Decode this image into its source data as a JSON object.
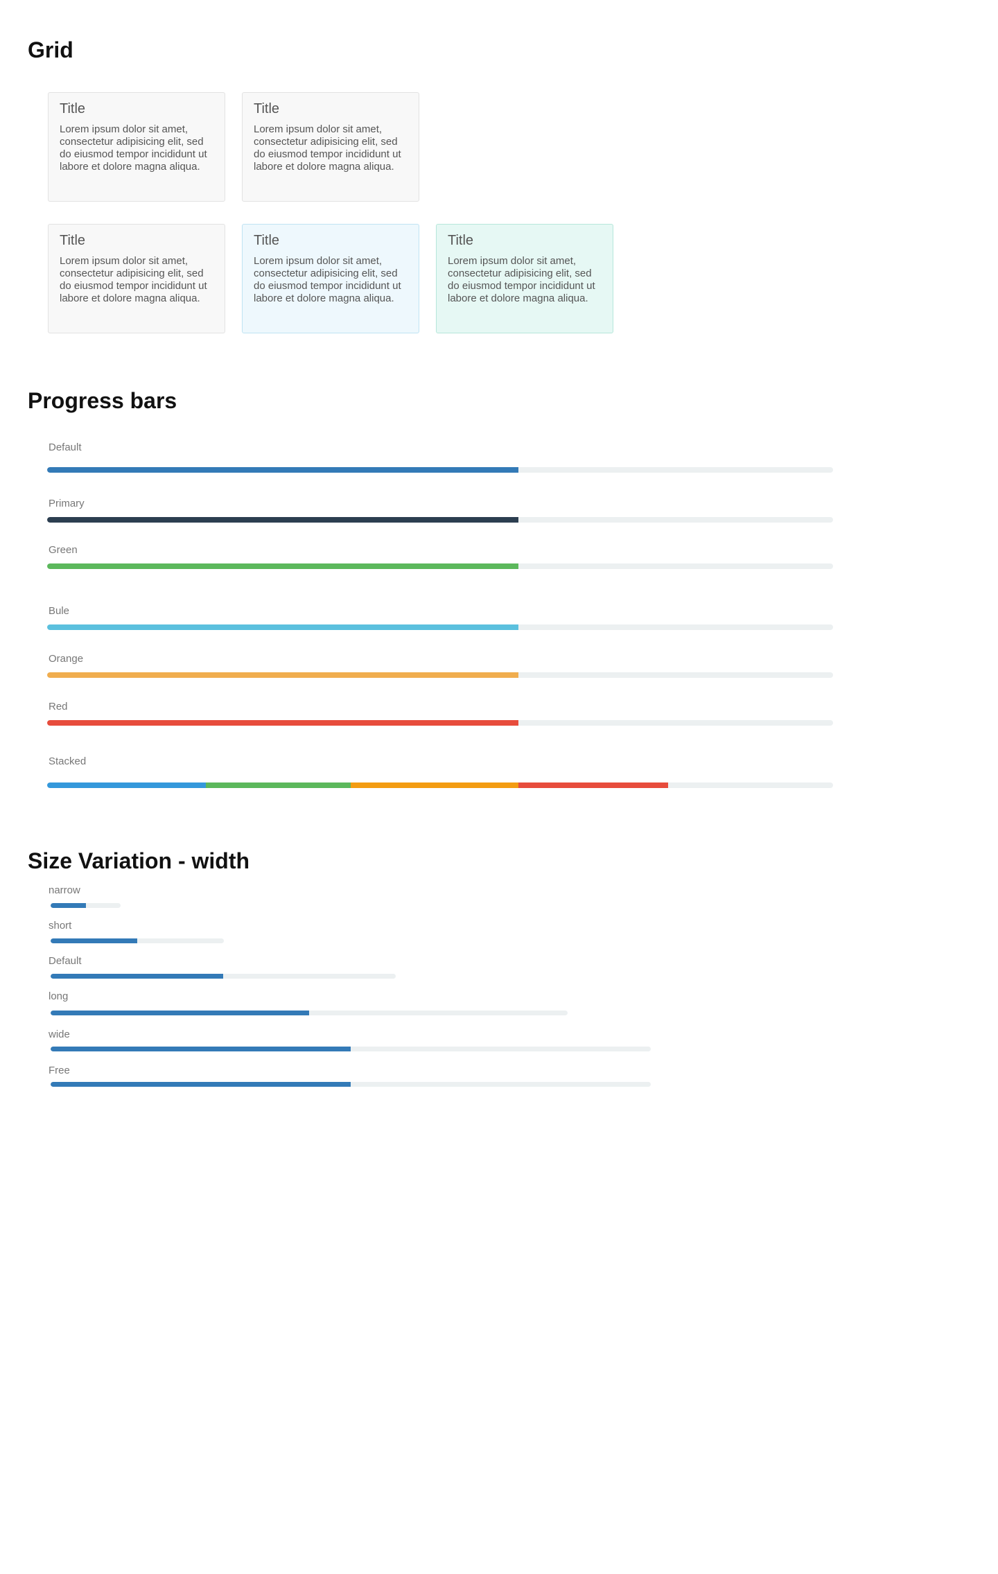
{
  "grid": {
    "heading": "Grid",
    "cards": [
      {
        "title": "Title",
        "body": "Lorem ipsum dolor sit amet, consectetur adipisicing elit, sed do eiusmod tempor incididunt ut labore et dolore magna aliqua.",
        "variant": "default"
      },
      {
        "title": "Title",
        "body": "Lorem ipsum dolor sit amet, consectetur adipisicing elit, sed do eiusmod tempor incididunt ut labore et dolore magna aliqua.",
        "variant": "default"
      },
      {
        "title": "Title",
        "body": "Lorem ipsum dolor sit amet, consectetur adipisicing elit, sed do eiusmod tempor incididunt ut labore et dolore magna aliqua.",
        "variant": "default"
      },
      {
        "title": "Title",
        "body": "Lorem ipsum dolor sit amet, consectetur adipisicing elit, sed do eiusmod tempor incididunt ut labore et dolore magna aliqua.",
        "variant": "blue"
      },
      {
        "title": "Title",
        "body": "Lorem ipsum dolor sit amet, consectetur adipisicing elit, sed do eiusmod tempor incididunt ut labore et dolore magna aliqua.",
        "variant": "mint"
      }
    ]
  },
  "progress": {
    "heading": "Progress bars",
    "bars": [
      {
        "label": "Default",
        "percent": 60,
        "color": "#337ab7"
      },
      {
        "label": "Primary",
        "percent": 60,
        "color": "#2c3e50"
      },
      {
        "label": "Green",
        "percent": 60,
        "color": "#5cb85c"
      },
      {
        "label": "Bule",
        "percent": 60,
        "color": "#5bc0de"
      },
      {
        "label": "Orange",
        "percent": 60,
        "color": "#f0ad4e"
      },
      {
        "label": "Red",
        "percent": 60,
        "color": "#e74c3c"
      }
    ],
    "stacked": {
      "label": "Stacked",
      "segments": [
        {
          "percent": 20.2,
          "color": "#3498db"
        },
        {
          "percent": 18.4,
          "color": "#5cb85c"
        },
        {
          "percent": 21.4,
          "color": "#f39c12"
        },
        {
          "percent": 19.0,
          "color": "#e74c3c"
        }
      ]
    }
  },
  "sizes": {
    "heading": "Size Variation - width",
    "color": "#337ab7",
    "bars": [
      {
        "label": "narrow",
        "percent": 50
      },
      {
        "label": "short",
        "percent": 50
      },
      {
        "label": "Default",
        "percent": 50
      },
      {
        "label": "long",
        "percent": 50
      },
      {
        "label": "wide",
        "percent": 50
      },
      {
        "label": "Free",
        "percent": 50
      }
    ]
  }
}
